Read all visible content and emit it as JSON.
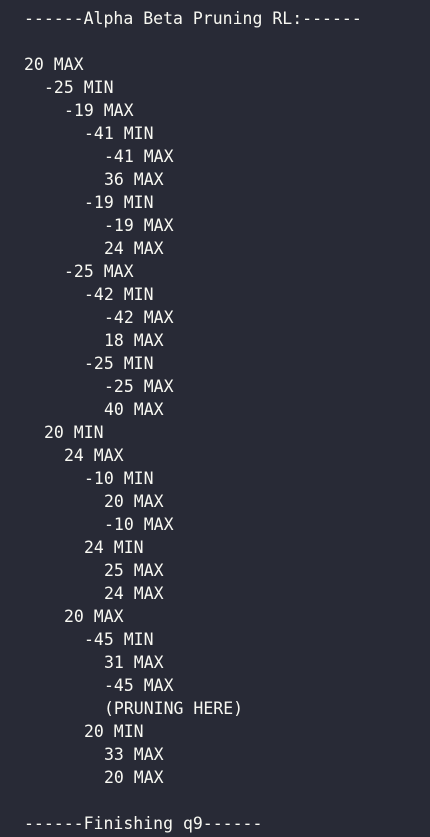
{
  "console": {
    "header": "------Alpha Beta Pruning RL:------",
    "footer": "------Finishing q9------",
    "lines": [
      {
        "depth": 0,
        "text": "20 MAX"
      },
      {
        "depth": 1,
        "text": "-25 MIN"
      },
      {
        "depth": 2,
        "text": "-19 MAX"
      },
      {
        "depth": 3,
        "text": "-41 MIN"
      },
      {
        "depth": 4,
        "text": "-41 MAX"
      },
      {
        "depth": 4,
        "text": "36 MAX"
      },
      {
        "depth": 3,
        "text": "-19 MIN"
      },
      {
        "depth": 4,
        "text": "-19 MAX"
      },
      {
        "depth": 4,
        "text": "24 MAX"
      },
      {
        "depth": 2,
        "text": "-25 MAX"
      },
      {
        "depth": 3,
        "text": "-42 MIN"
      },
      {
        "depth": 4,
        "text": "-42 MAX"
      },
      {
        "depth": 4,
        "text": "18 MAX"
      },
      {
        "depth": 3,
        "text": "-25 MIN"
      },
      {
        "depth": 4,
        "text": "-25 MAX"
      },
      {
        "depth": 4,
        "text": "40 MAX"
      },
      {
        "depth": 1,
        "text": "20 MIN"
      },
      {
        "depth": 2,
        "text": "24 MAX"
      },
      {
        "depth": 3,
        "text": "-10 MIN"
      },
      {
        "depth": 4,
        "text": "20 MAX"
      },
      {
        "depth": 4,
        "text": "-10 MAX"
      },
      {
        "depth": 3,
        "text": "24 MIN"
      },
      {
        "depth": 4,
        "text": "25 MAX"
      },
      {
        "depth": 4,
        "text": "24 MAX"
      },
      {
        "depth": 2,
        "text": "20 MAX"
      },
      {
        "depth": 3,
        "text": "-45 MIN"
      },
      {
        "depth": 4,
        "text": "31 MAX"
      },
      {
        "depth": 4,
        "text": "-45 MAX"
      },
      {
        "depth": 4,
        "text": "(PRUNING HERE)"
      },
      {
        "depth": 3,
        "text": "20 MIN"
      },
      {
        "depth": 4,
        "text": "33 MAX"
      },
      {
        "depth": 4,
        "text": "20 MAX"
      }
    ]
  }
}
